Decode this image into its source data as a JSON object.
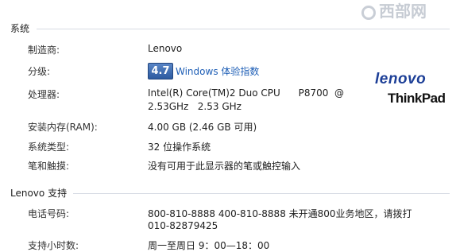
{
  "watermark": {
    "text": "西部网",
    "icon": "watermark-circle-icon"
  },
  "system": {
    "title": "系统",
    "manufacturer": {
      "label": "制造商:",
      "value": "Lenovo"
    },
    "rating": {
      "label": "分级:",
      "score": "4.7",
      "link": "Windows 体验指数",
      "badge_color": "#2c5aa0"
    },
    "processor": {
      "label": "处理器:",
      "line1": "Intel(R) Core(TM)2 Duo CPU      P8700  @",
      "line2": "2.53GHz   2.53 GHz"
    },
    "memory": {
      "label": "安装内存(RAM):",
      "value": "4.00 GB (2.46 GB 可用)"
    },
    "system_type": {
      "label": "系统类型:",
      "value": "32 位操作系统"
    },
    "pen_touch": {
      "label": "笔和触摸:",
      "value": "没有可用于此显示器的笔或触控输入"
    }
  },
  "logo": {
    "brand": "lenovo",
    "product": "ThinkPad",
    "brand_color": "#1d3f97"
  },
  "support": {
    "title": "Lenovo 支持",
    "phone": {
      "label": "电话号码:",
      "line1": "800-810-8888 400-810-8888 未开通800业务地区，请拨打",
      "line2": "010-82879425"
    },
    "hours": {
      "label": "支持小时数:",
      "value": "周一至周日 9：00—18：00"
    }
  }
}
